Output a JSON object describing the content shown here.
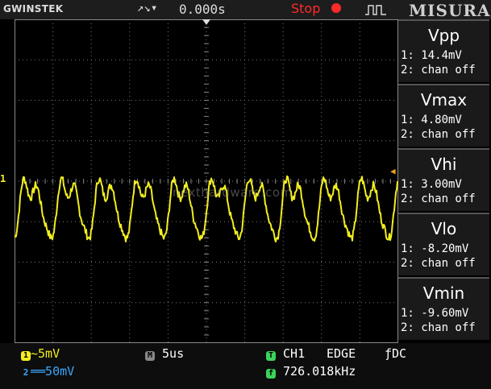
{
  "top_bar": {
    "brand": "GWINSTEK",
    "trigger_icons": "↗↘▾",
    "time_position": "0.000s",
    "status": "Stop",
    "panel_title": "MISURA"
  },
  "screen": {
    "channel_marker": "1",
    "watermark": "nexthardware.com"
  },
  "measurements": [
    {
      "name": "Vpp",
      "ch1": "1: 14.4mV",
      "ch2": "2: chan off"
    },
    {
      "name": "Vmax",
      "ch1": "1: 4.80mV",
      "ch2": "2: chan off"
    },
    {
      "name": "Vhi",
      "ch1": "1: 3.00mV",
      "ch2": "2: chan off"
    },
    {
      "name": "Vlo",
      "ch1": "1: -8.20mV",
      "ch2": "2: chan off"
    },
    {
      "name": "Vmin",
      "ch1": "1: -9.60mV",
      "ch2": "2: chan off"
    }
  ],
  "bottom_bar": {
    "ch1_scale": "~5mV",
    "ch2_scale": "══50mV",
    "timebase": "5us",
    "trigger_source": "CH1",
    "trigger_type": "EDGE",
    "coupling": "ƒDC",
    "frequency": "726.018kHz"
  },
  "colors": {
    "ch1": "#f2ee1f",
    "ch2": "#3aa7ff",
    "status": "#ff2a2a",
    "trigger_level": "#f0a020"
  },
  "icons": [
    "pulse-waveform-icon",
    "trigger-edge-icon",
    "stop-indicator-icon"
  ]
}
